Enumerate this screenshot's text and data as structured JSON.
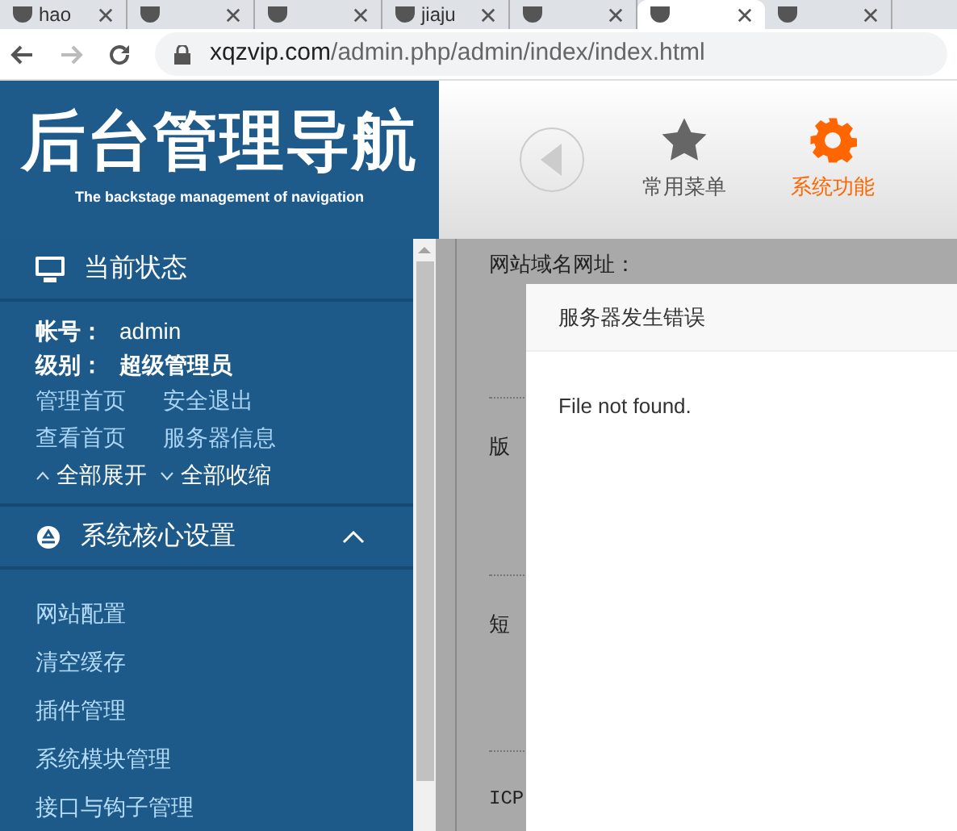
{
  "browser": {
    "tabs": [
      {
        "title": "hao",
        "selected": false
      },
      {
        "selected": false
      },
      {
        "selected": false
      },
      {
        "title": "jiaju",
        "selected": false
      },
      {
        "selected": false
      },
      {
        "selected": true
      },
      {
        "selected": false
      }
    ],
    "url_host": "xqzvip.com",
    "url_path": "/admin.php/admin/index/index.html"
  },
  "header": {
    "logo_title": "后台管理导航",
    "logo_subtitle": "The backstage management of navigation",
    "nav": [
      {
        "label": "常用菜单",
        "kind": "star",
        "selected": false
      },
      {
        "label": "系统功能",
        "kind": "gear",
        "selected": true
      }
    ]
  },
  "sidebar": {
    "status_title": "当前状态",
    "account_label": "帐号：",
    "account": "admin",
    "level_label": "级别：",
    "level_value": "超级管理员",
    "links": [
      "管理首页",
      "安全退出",
      "查看首页",
      "服务器信息"
    ],
    "expand_all": "全部展开",
    "collapse_all": "全部收缩",
    "section": {
      "title": "系统核心设置",
      "expanded": true,
      "items": [
        "网站配置",
        "清空缓存",
        "插件管理",
        "系统模块管理",
        "接口与钩子管理"
      ]
    }
  },
  "form_labels": [
    "网站域名网址：",
    "版",
    "短",
    "ICP"
  ],
  "dialog": {
    "title": "服务器发生错误",
    "message": "File not found."
  }
}
